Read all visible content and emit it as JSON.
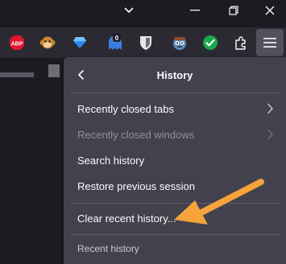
{
  "window_controls": {
    "tabs_dropdown_icon": "chevron-down-icon",
    "minimize_icon": "minimize-icon",
    "restore_icon": "restore-icon",
    "close_icon": "close-icon"
  },
  "toolbar": {
    "extensions": [
      {
        "name": "abp-extension",
        "label": "ABP",
        "color": "#e0152d"
      },
      {
        "name": "monkey-extension",
        "label": "",
        "color": "#c98a35"
      },
      {
        "name": "diamond-extension",
        "label": "",
        "color": "#2b8ef0"
      },
      {
        "name": "ghost-extension",
        "label": "0",
        "color": "#3d7be0"
      },
      {
        "name": "shield-extension",
        "label": "",
        "color": "#e5e5ea"
      },
      {
        "name": "face-extension",
        "label": "",
        "color": "#5f8fbf"
      },
      {
        "name": "check-extension",
        "label": "",
        "color": "#18a848"
      }
    ],
    "puzzle_icon": "puzzle-icon",
    "menu_icon": "hamburger-menu-icon"
  },
  "panel": {
    "title": "History",
    "items": [
      {
        "label": "Recently closed tabs",
        "enabled": true,
        "submenu": true
      },
      {
        "label": "Recently closed windows",
        "enabled": false,
        "submenu": true
      },
      {
        "label": "Search history",
        "enabled": true,
        "submenu": false
      },
      {
        "label": "Restore previous session",
        "enabled": true,
        "submenu": false
      },
      {
        "label": "Clear recent history...",
        "enabled": true,
        "submenu": false
      }
    ],
    "recent_history_label": "Recent history"
  },
  "colors": {
    "panel_bg": "#42414d",
    "toolbar_bg": "#2b2a33",
    "annotation_arrow": "#f5a33a"
  }
}
